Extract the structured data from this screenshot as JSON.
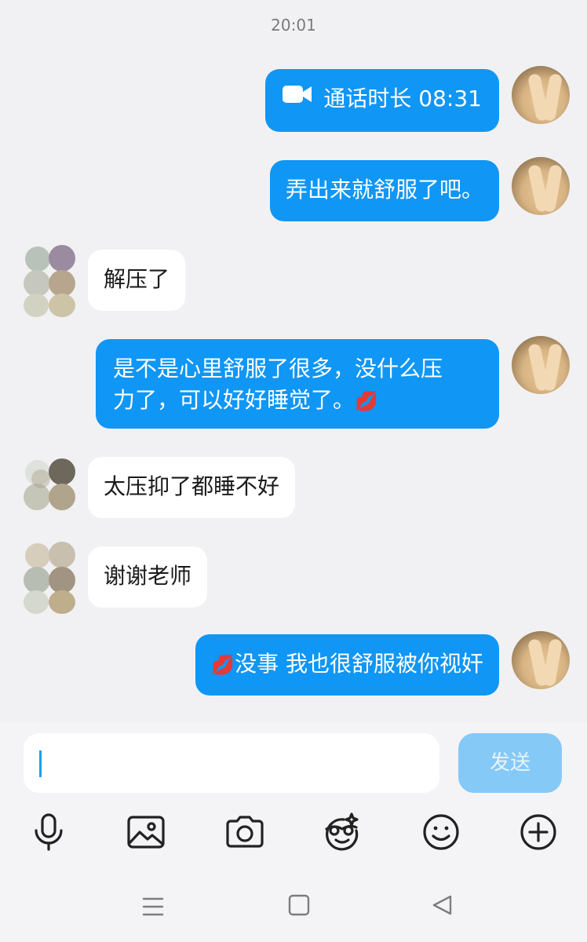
{
  "header": {
    "time": "20:01"
  },
  "messages": [
    {
      "from": "me",
      "type": "video_call",
      "text": "通话时长 08:31",
      "icon": "video-camera-icon"
    },
    {
      "from": "me",
      "type": "text",
      "text": "弄出来就舒服了吧。"
    },
    {
      "from": "other",
      "type": "text",
      "text": "解压了"
    },
    {
      "from": "me",
      "type": "text",
      "line1": "是不是心里舒服了很多，没什么压",
      "line2": "力了，可以好好睡觉了。",
      "emoji": "💋"
    },
    {
      "from": "other",
      "type": "text",
      "text": "太压抑了都睡不好"
    },
    {
      "from": "other",
      "type": "text",
      "text": "谢谢老师"
    },
    {
      "from": "me",
      "type": "text",
      "emoji": "💋",
      "text": "没事 我也很舒服被你视奸"
    }
  ],
  "composer": {
    "input_value": "",
    "send_label": "发送"
  },
  "toolbar": [
    "microphone-icon",
    "image-icon",
    "camera-icon",
    "sticker-icon",
    "emoji-icon",
    "plus-icon"
  ],
  "navbar": [
    "menu-icon",
    "home-icon",
    "back-icon"
  ],
  "colors": {
    "bubble_me": "#1096f5",
    "bubble_other": "#ffffff",
    "send_disabled": "#85c9f7",
    "background": "#f1f1f3"
  }
}
